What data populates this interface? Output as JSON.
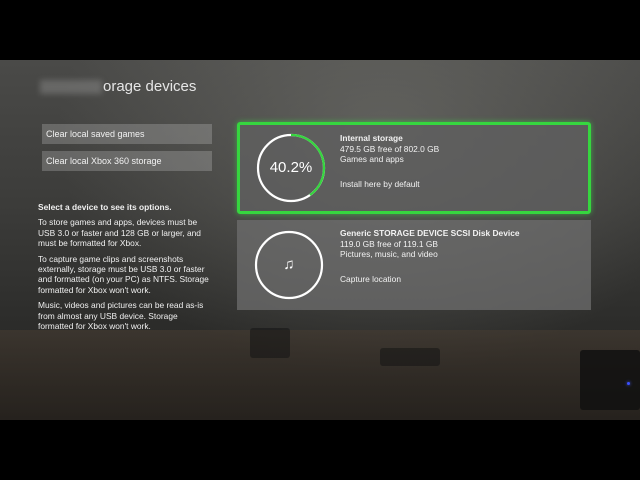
{
  "page": {
    "title": "orage devices"
  },
  "sidebar": {
    "buttons": [
      {
        "label": "Clear local saved games"
      },
      {
        "label": "Clear local Xbox 360 storage"
      }
    ],
    "heading": "Select a device to see its options.",
    "paragraphs": [
      "To store games and apps, devices must be USB 3.0 or faster and 128 GB or larger, and must be formatted for Xbox.",
      "To capture game clips and screenshots externally, storage must be USB 3.0 or faster and formatted (on your PC) as NTFS. Storage formatted for Xbox won't work.",
      "Music, videos and pictures can be read as-is from almost any USB device. Storage formatted for Xbox won't work."
    ]
  },
  "devices": [
    {
      "name": "Internal storage",
      "free": "479.5 GB free of 802.0 GB",
      "contents": "Games and apps",
      "action": "Install here by default",
      "usage_label": "40.2%",
      "usage_fraction": 0.402,
      "selected": true
    },
    {
      "name": "Generic STORAGE DEVICE SCSI Disk Device",
      "free": "119.0 GB free of 119.1 GB",
      "contents": "Pictures, music, and video",
      "action": "Capture location",
      "icon": "music-note-icon",
      "usage_fraction": 0.001,
      "selected": false
    }
  ],
  "colors": {
    "selection_accent": "#36d63f",
    "ring_used": "#36d63f",
    "ring_track": "#ffffff"
  }
}
